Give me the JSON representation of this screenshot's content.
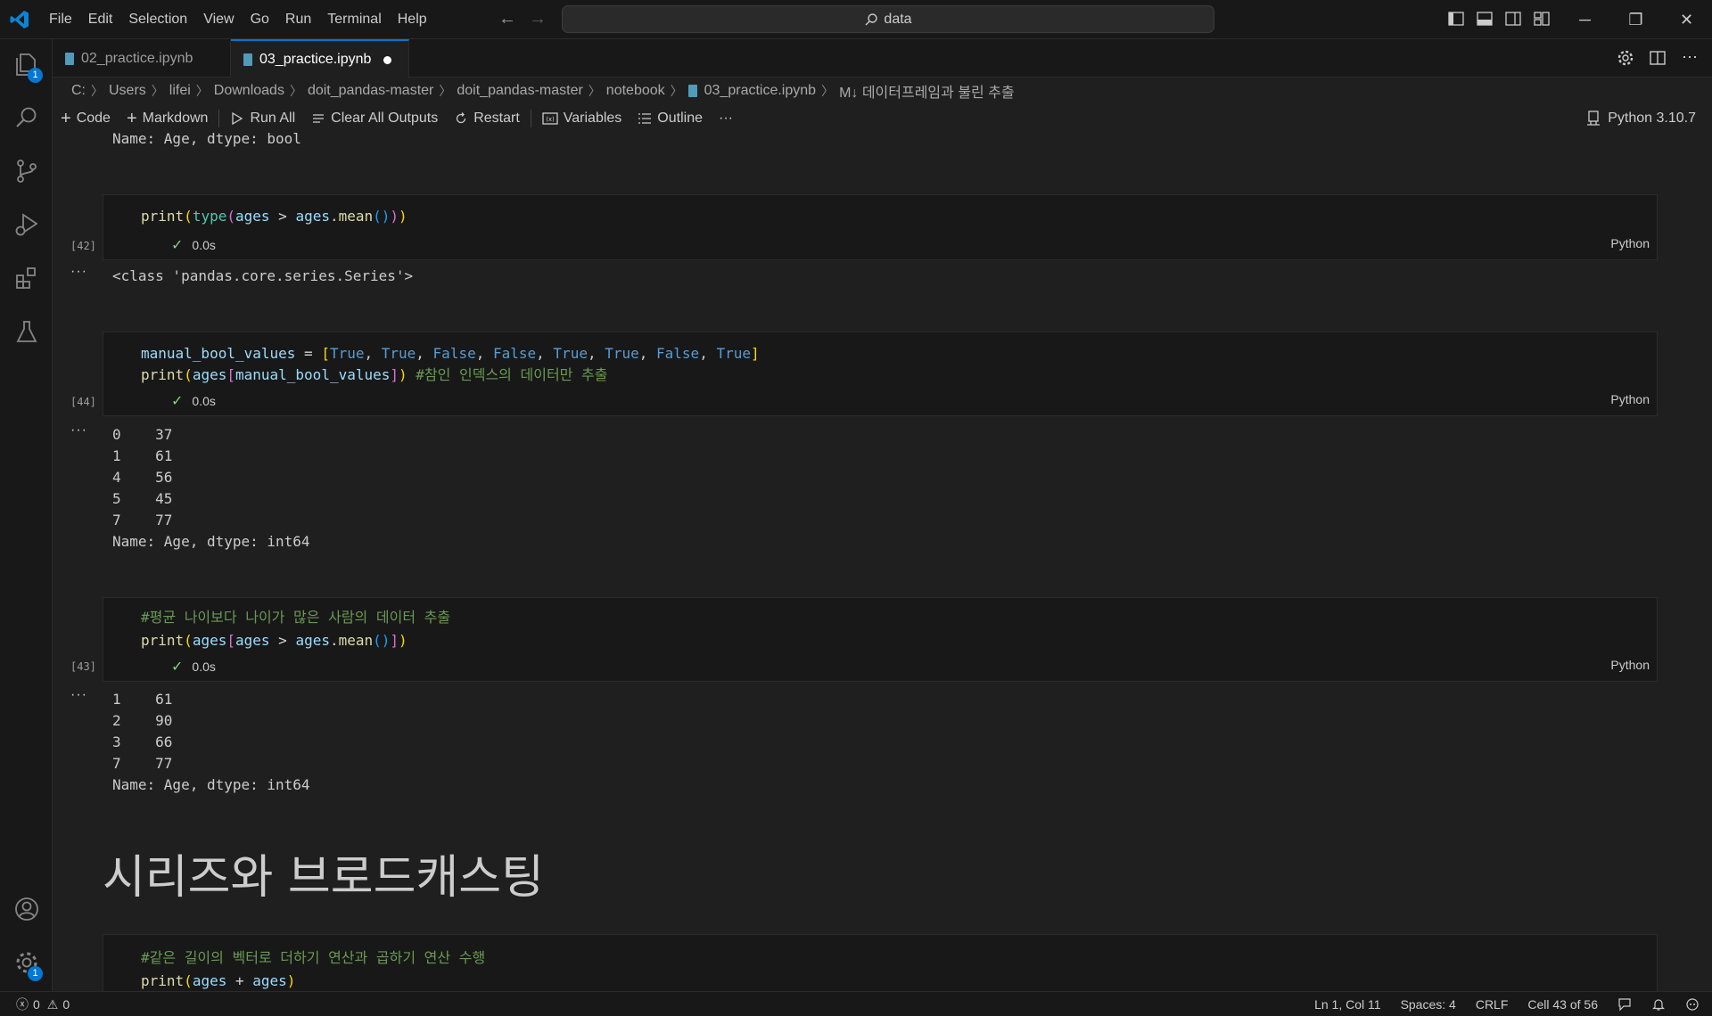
{
  "menu": [
    "File",
    "Edit",
    "Selection",
    "View",
    "Go",
    "Run",
    "Terminal",
    "Help"
  ],
  "command_center": {
    "text": "data"
  },
  "tabs": [
    {
      "label": "02_practice.ipynb",
      "active": false
    },
    {
      "label": "03_practice.ipynb",
      "active": true,
      "dirty": true
    }
  ],
  "breadcrumb": [
    "C:",
    "Users",
    "lifei",
    "Downloads",
    "doit_pandas-master",
    "doit_pandas-master",
    "notebook",
    "03_practice.ipynb",
    "M↓ 데이터프레임과 불린 추출"
  ],
  "toolbar": {
    "code": "Code",
    "markdown": "Markdown",
    "run_all": "Run All",
    "clear_outputs": "Clear All Outputs",
    "restart": "Restart",
    "variables": "Variables",
    "outline": "Outline",
    "more": "···",
    "kernel": "Python 3.10.7"
  },
  "cells": {
    "prev_output": "Name: Age, dtype: bool",
    "c42": {
      "count": "[42]",
      "time": "0.0s",
      "lang": "Python",
      "output": "<class 'pandas.core.series.Series'>"
    },
    "c44": {
      "count": "[44]",
      "time": "0.0s",
      "lang": "Python",
      "comment": "#참인 인덱스의 데이터만 추출",
      "output": [
        "0    37",
        "1    61",
        "4    56",
        "5    45",
        "7    77",
        "Name: Age, dtype: int64"
      ]
    },
    "c43": {
      "count": "[43]",
      "time": "0.0s",
      "lang": "Python",
      "comment": "#평균 나이보다 나이가 많은 사람의 데이터 추출",
      "output": [
        "1    61",
        "2    90",
        "3    66",
        "7    77",
        "Name: Age, dtype: int64"
      ]
    },
    "heading": "시리즈와 브로드캐스팅",
    "c_next": {
      "comment": "#같은 길이의 벡터로 더하기 연산과 곱하기 연산 수행"
    },
    "output_dots": "···"
  },
  "statusbar": {
    "errors": "0",
    "warnings": "0",
    "position": "Ln 1, Col 11",
    "spaces": "Spaces: 4",
    "eol": "CRLF",
    "cell": "Cell 43 of 56"
  },
  "badges": {
    "explorer": "1",
    "settings": "1"
  },
  "colors": {
    "accent": "#0078d4",
    "success": "#89d185"
  }
}
